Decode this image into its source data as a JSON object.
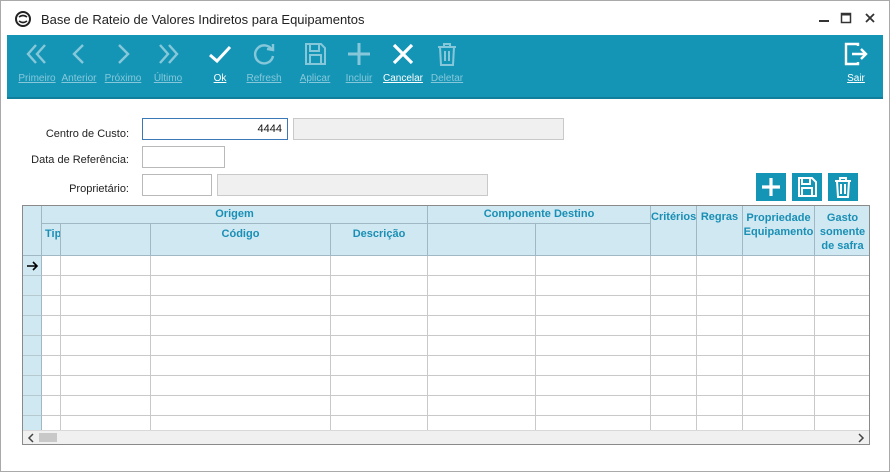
{
  "window": {
    "title": "Base de Rateio de Valores Indiretos para Equipamentos"
  },
  "toolbar": {
    "primeiro": "Primeiro",
    "anterior": "Anterior",
    "proximo": "Próximo",
    "ultimo": "Último",
    "ok": "Ok",
    "refresh": "Refresh",
    "aplicar": "Aplicar",
    "incluir": "Incluir",
    "cancelar": "Cancelar",
    "deletar": "Deletar",
    "sair": "Sair"
  },
  "form": {
    "centro_custo_label": "Centro de Custo:",
    "centro_custo_value": "4444",
    "data_ref_label": "Data de Referência:",
    "data_ref_value": "",
    "proprietario_label": "Proprietário:",
    "proprietario_value": ""
  },
  "grid": {
    "group_origem": "Origem",
    "group_componente": "Componente Destino",
    "col_tipo": "Tip",
    "col_codigo": "Código",
    "col_descricao": "Descrição",
    "col_criterios": "Critérios",
    "col_regras": "Regras",
    "col_propriedade_1": "Propriedade",
    "col_propriedade_2": "Equipamento",
    "col_gasto_1": "Gasto",
    "col_gasto_2": "somente",
    "col_gasto_3": "de safra",
    "row_count": 9
  },
  "colors": {
    "accent": "#1595b6",
    "header": "#cfe8f1",
    "header_text": "#1a8fb5"
  }
}
